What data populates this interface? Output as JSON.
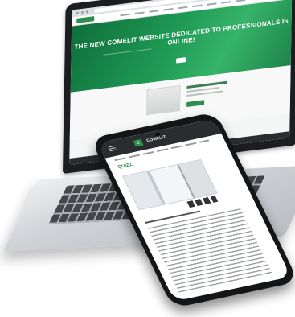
{
  "laptop": {
    "hero_headline": "THE NEW COMELIT WEBSITE DEDICATED TO PROFESSIONALS IS ONLINE!"
  },
  "phone": {
    "logo_mark": "C",
    "brand": "COMELIT",
    "page_title": "QUIZZ"
  },
  "colors": {
    "brand_green": "#2d8f4e",
    "hero_green": "#1f9a55",
    "device_black": "#141517",
    "laptop_silver": "#cfd2d6"
  }
}
